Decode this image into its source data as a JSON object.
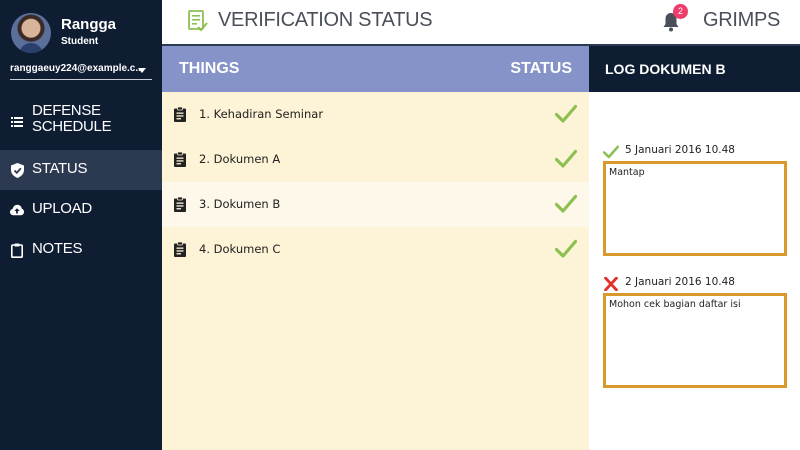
{
  "profile": {
    "name": "Rangga",
    "role": "Student",
    "email": "ranggaeuy224@example.c..."
  },
  "sidebar": {
    "items": [
      {
        "label": "DEFENSE SCHEDULE",
        "icon": "list-icon",
        "active": false
      },
      {
        "label": "STATUS",
        "icon": "shield-check-icon",
        "active": true
      },
      {
        "label": "UPLOAD",
        "icon": "cloud-upload-icon",
        "active": false
      },
      {
        "label": "NOTES",
        "icon": "clipboard-icon",
        "active": false
      }
    ]
  },
  "header": {
    "title": "VERIFICATION STATUS",
    "title_icon": "checklist-icon",
    "notification_count": "2",
    "brand": "GRIMPS"
  },
  "table": {
    "columns": [
      "THINGS",
      "STATUS"
    ],
    "rows": [
      {
        "label": "1. Kehadiran Seminar",
        "status": "verified"
      },
      {
        "label": "2. Dokumen A",
        "status": "verified"
      },
      {
        "label": "3. Dokumen B",
        "status": "verified"
      },
      {
        "label": "4. Dokumen C",
        "status": "verified"
      }
    ]
  },
  "log": {
    "title": "LOG DOKUMEN B",
    "entries": [
      {
        "status": "approved",
        "date": "5 Januari 2016 10.48",
        "note": "Mantap"
      },
      {
        "status": "rejected",
        "date": "2 Januari 2016 10.48",
        "note": "Mohon cek bagian daftar isi"
      }
    ]
  },
  "colors": {
    "sidebar_bg": "#0f1d33",
    "sidebar_active": "#2c3a51",
    "table_header": "#8593c9",
    "table_bg": "#fdf3d6",
    "check_green": "#8cc152",
    "reject_red": "#e0322b",
    "note_border": "#d99a2b",
    "badge": "#ee3d6b",
    "header_icon_green": "#8cc152"
  }
}
